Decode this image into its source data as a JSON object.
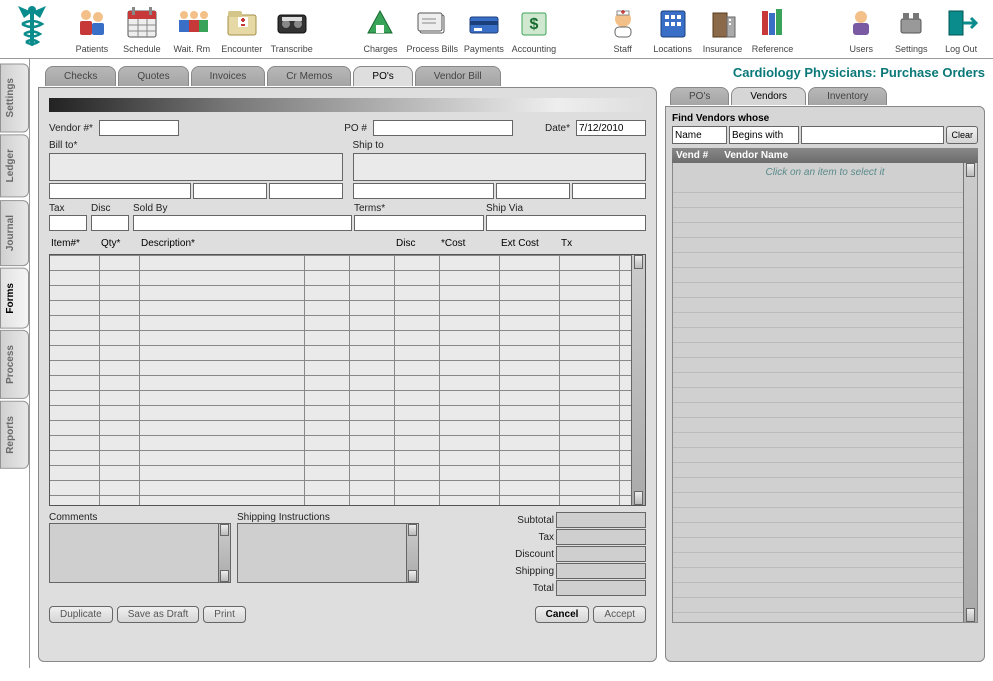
{
  "toolbar": [
    {
      "key": "patients",
      "label": "Patients"
    },
    {
      "key": "schedule",
      "label": "Schedule"
    },
    {
      "key": "waitrm",
      "label": "Wait. Rm"
    },
    {
      "key": "encounter",
      "label": "Encounter"
    },
    {
      "key": "transcribe",
      "label": "Transcribe"
    },
    {
      "key": "gap"
    },
    {
      "key": "charges",
      "label": "Charges"
    },
    {
      "key": "processbills",
      "label": "Process Bills"
    },
    {
      "key": "payments",
      "label": "Payments"
    },
    {
      "key": "accounting",
      "label": "Accounting"
    },
    {
      "key": "gap"
    },
    {
      "key": "staff",
      "label": "Staff"
    },
    {
      "key": "locations",
      "label": "Locations"
    },
    {
      "key": "insurance",
      "label": "Insurance"
    },
    {
      "key": "reference",
      "label": "Reference"
    },
    {
      "key": "gap"
    },
    {
      "key": "users",
      "label": "Users"
    },
    {
      "key": "settings",
      "label": "Settings"
    },
    {
      "key": "logout",
      "label": "Log Out"
    }
  ],
  "side_tabs": [
    {
      "key": "settings",
      "label": "Settings"
    },
    {
      "key": "ledger",
      "label": "Ledger"
    },
    {
      "key": "journal",
      "label": "Journal"
    },
    {
      "key": "forms",
      "label": "Forms",
      "active": true
    },
    {
      "key": "process",
      "label": "Process"
    },
    {
      "key": "reports",
      "label": "Reports"
    }
  ],
  "h_tabs": [
    {
      "key": "checks",
      "label": "Checks"
    },
    {
      "key": "quotes",
      "label": "Quotes"
    },
    {
      "key": "invoices",
      "label": "Invoices"
    },
    {
      "key": "crmemos",
      "label": "Cr Memos"
    },
    {
      "key": "pos",
      "label": "PO's",
      "active": true
    },
    {
      "key": "vendorbill",
      "label": "Vendor Bill"
    }
  ],
  "form": {
    "vendor_num_label": "Vendor #*",
    "po_num_label": "PO #",
    "date_label": "Date*",
    "date_value": "7/12/2010",
    "bill_to_label": "Bill to*",
    "ship_to_label": "Ship to",
    "tax_label": "Tax",
    "disc_label": "Disc",
    "sold_by_label": "Sold By",
    "terms_label": "Terms*",
    "ship_via_label": "Ship Via",
    "grid_headers": {
      "item": "Item#*",
      "qty": "Qty*",
      "description": "Description*",
      "disc": "Disc",
      "cost": "*Cost",
      "ext": "Ext Cost",
      "tx": "Tx"
    },
    "comments_label": "Comments",
    "shipping_instructions_label": "Shipping Instructions",
    "totals": {
      "subtotal": "Subtotal",
      "tax": "Tax",
      "discount": "Discount",
      "shipping": "Shipping",
      "total": "Total"
    },
    "buttons": {
      "duplicate": "Duplicate",
      "save_draft": "Save as Draft",
      "print": "Print",
      "cancel": "Cancel",
      "accept": "Accept"
    }
  },
  "page_title": "Cardiology Physicians:  Purchase Orders",
  "r_tabs": [
    {
      "key": "pos",
      "label": "PO's"
    },
    {
      "key": "vendors",
      "label": "Vendors",
      "active": true
    },
    {
      "key": "inventory",
      "label": "Inventory"
    }
  ],
  "find": {
    "heading": "Find Vendors whose",
    "field": "Name",
    "op": "Begins with",
    "clear": "Clear"
  },
  "vendor_head": {
    "num": "Vend #",
    "name": "Vendor Name"
  },
  "vendor_hint": "Click on an item to select it"
}
